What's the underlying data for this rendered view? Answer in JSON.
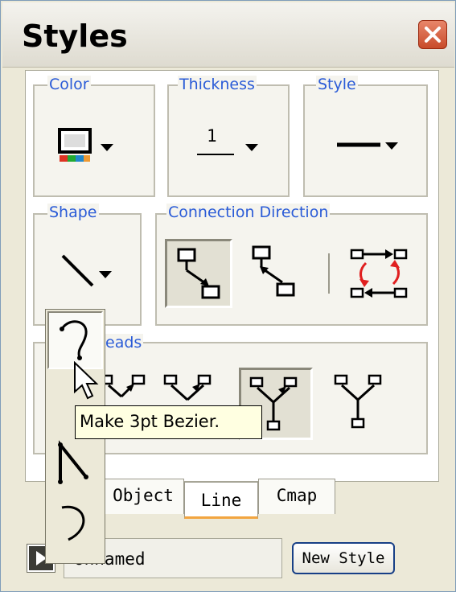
{
  "window": {
    "title": "Styles"
  },
  "groups": {
    "color": {
      "label": "Color"
    },
    "thickness": {
      "label": "Thickness",
      "value": "1"
    },
    "style": {
      "label": "Style"
    },
    "shape": {
      "label": "Shape"
    },
    "connection_direction": {
      "label": "Connection Direction"
    },
    "arrowheads": {
      "label": "eads"
    }
  },
  "tabs": [
    {
      "label": "Object"
    },
    {
      "label": "Line",
      "active": true
    },
    {
      "label": "Cmap"
    }
  ],
  "tooltip": {
    "text": "Make 3pt Bezier."
  },
  "shape_menu": {
    "items": [
      "curve-3pt-bezier",
      "polyline",
      "arc"
    ]
  },
  "footer": {
    "style_name": "Unnamed",
    "new_style_label": "New Style"
  },
  "icons": {
    "close": "close-icon",
    "color": "monitor-color-icon",
    "dropdown": "chevron-down-icon",
    "connection": [
      "connection-forward-icon",
      "connection-backward-icon",
      "connection-bidirectional-icon"
    ],
    "arrowhead": [
      "arrowhead-both-icon",
      "arrowhead-middle-icon",
      "arrowhead-none-icon"
    ]
  },
  "colors": {
    "accent_label": "#2a5bd7",
    "tab_highlight": "#f2a540",
    "tooltip_bg": "#ffffe1"
  }
}
